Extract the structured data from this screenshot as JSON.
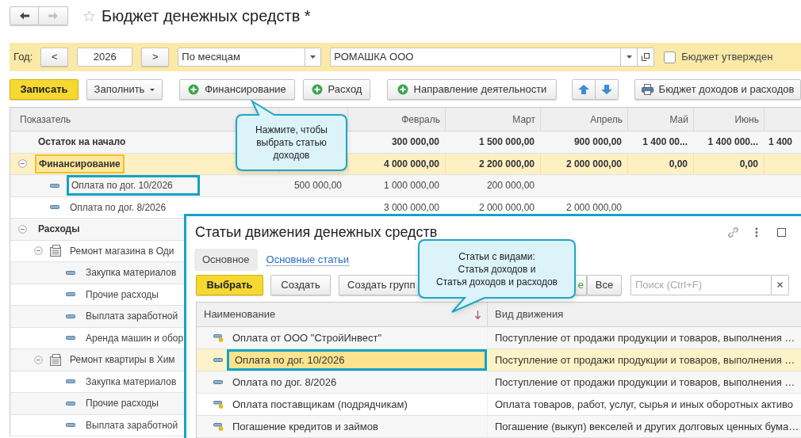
{
  "nav_buttons": [
    {
      "kind": "back",
      "disabled": false
    },
    {
      "kind": "forward",
      "disabled": true
    }
  ],
  "title": "Бюджет денежных средств *",
  "favorite": false,
  "filter": {
    "year_label": "Год:",
    "prev": "<",
    "year": "2026",
    "next": ">",
    "period": "По месяцам",
    "organization": "РОМАШКА ООО",
    "approved": {
      "label": "Бюджет утвержден",
      "checked": false
    }
  },
  "toolbar": [
    {
      "label": "Записать",
      "kind": "primary"
    },
    {
      "label": "Заполнить",
      "kind": "menu"
    },
    {
      "label": "Финансирование",
      "kind": "add"
    },
    {
      "label": "Расход",
      "kind": "add"
    },
    {
      "label": "Направление деятельности",
      "kind": "add"
    },
    {
      "kind": "arrows"
    },
    {
      "label": "Бюджет доходов и расходов",
      "kind": "print"
    }
  ],
  "table": {
    "columns": [
      {
        "label": "Показатель"
      },
      {},
      {
        "label": "Февраль"
      },
      {
        "label": "Март"
      },
      {
        "label": "Апрель"
      },
      {
        "label": "Май"
      },
      {
        "label": "Июнь"
      },
      {}
    ],
    "rows": [
      {
        "name": "Остаток на начало",
        "selected": false,
        "focused": false,
        "outlined": false,
        "values": {
          "column_3": "300 000,00",
          "column_4": "1 500 000,00",
          "column_5": "900 000,00",
          "column_6": "1 400 00...",
          "column_7": "1 400 000...",
          "column_8": "1 400"
        }
      },
      {
        "name": "Финансирование",
        "expanded": true,
        "selected": true,
        "focused": true,
        "outlined": false,
        "values": {
          "column_3": "4 000 000,00",
          "column_4": "2 200 000,00",
          "column_5": "2 000 000,00",
          "column_6": "0,00",
          "column_7": "0,00"
        },
        "children": [
          {
            "name": "Оплата по дог. 10/2026",
            "kind": "item",
            "selected": false,
            "focused": false,
            "outlined": true,
            "values": {
              "column_2": "500 000,00",
              "column_3": "1 000 000,00",
              "column_4": "200 000,00"
            }
          },
          {
            "name": "Оплата по дог. 8/2026",
            "kind": "item",
            "selected": false,
            "focused": false,
            "outlined": false,
            "values": {
              "column_3": "3 000 000,00",
              "column_4": "2 000 000,00",
              "column_5": "2 000 000,00"
            }
          }
        ]
      },
      {
        "name": "Расходы",
        "expanded": true,
        "selected": false,
        "focused": false,
        "outlined": false,
        "children": [
          {
            "name": "Ремонт магазина в Оди",
            "kind": "project",
            "expanded": true,
            "selected": false,
            "focused": false,
            "outlined": false,
            "children": [
              {
                "name": "Закупка материалов",
                "kind": "item",
                "selected": false,
                "focused": false,
                "outlined": false
              },
              {
                "name": "Прочие расходы",
                "kind": "item",
                "selected": false,
                "focused": false,
                "outlined": false
              },
              {
                "name": "Выплата заработной",
                "kind": "item",
                "selected": false,
                "focused": false,
                "outlined": false
              },
              {
                "name": "Аренда машин и обор",
                "kind": "item",
                "selected": false,
                "focused": false,
                "outlined": false
              }
            ]
          },
          {
            "name": "Ремонт квартиры в Хим",
            "kind": "project",
            "expanded": true,
            "selected": false,
            "focused": false,
            "outlined": false,
            "children": [
              {
                "name": "Закупка материалов",
                "kind": "item",
                "selected": false,
                "focused": false,
                "outlined": false
              },
              {
                "name": "Прочие расходы",
                "kind": "item",
                "selected": false,
                "focused": false,
                "outlined": false
              },
              {
                "name": "Выплата заработной",
                "kind": "item",
                "selected": false,
                "focused": false,
                "outlined": false
              }
            ]
          }
        ]
      }
    ]
  },
  "callouts": [
    {
      "text": "Нажмите, чтобы\nвыбрать статью\nдоходов"
    },
    {
      "text": "Статьи с видами:\nСтатья доходов и\nСтатья доходов и расходов"
    }
  ],
  "popup": {
    "title": "Статьи движения денежных средств",
    "tabs": [
      {
        "label": "Основное",
        "selected": true
      },
      {
        "label": "Основные статьи",
        "selected": false
      }
    ],
    "buttons": [
      {
        "label": "Выбрать",
        "kind": "primary"
      },
      {
        "label": "Создать",
        "kind": "plain"
      },
      {
        "label": "Создать групп",
        "kind": "plain"
      },
      {
        "label": "е",
        "kind": "partial"
      },
      {
        "label": "Все",
        "kind": "plain"
      }
    ],
    "search": {
      "placeholder": "Поиск (Ctrl+F)"
    },
    "columns": [
      {
        "label": "Наименование",
        "sorted": true
      },
      {
        "label": "Вид движения",
        "sorted": false
      }
    ],
    "rows": [
      {
        "name": "Оплата от ООО \"СтройИнвест\"",
        "kind": "dot",
        "selected": false,
        "outlined": false,
        "movement": "Поступление от продажи продукции и товаров, выполнения …"
      },
      {
        "name": "Оплата по дог. 10/2026",
        "kind": "plain",
        "selected": true,
        "outlined": true,
        "movement": "Поступление от продажи продукции и товаров, выполнения …"
      },
      {
        "name": "Оплата по дог. 8/2026",
        "kind": "plain",
        "selected": false,
        "outlined": false,
        "movement": "Поступление от продажи продукции и товаров, выполнения …"
      },
      {
        "name": "Оплата поставщикам (подрядчикам)",
        "kind": "dot",
        "selected": false,
        "outlined": false,
        "movement": "Оплата товаров, работ, услуг, сырья и иных оборотных активо"
      },
      {
        "name": "Погашение кредитов и займов",
        "kind": "dot",
        "selected": false,
        "outlined": false,
        "movement": "Погашение (выкуп) векселей и других долговых ценных бума…"
      }
    ]
  }
}
